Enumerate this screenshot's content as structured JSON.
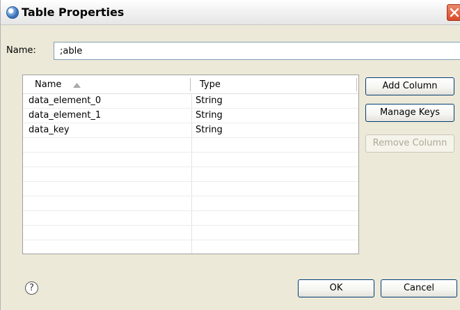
{
  "window": {
    "title": "Table Properties"
  },
  "name_field": {
    "label": "Name:",
    "value": ";able"
  },
  "table": {
    "columns": [
      "Name",
      "Type"
    ],
    "rows": [
      {
        "name": "data_element_0",
        "type": "String"
      },
      {
        "name": "data_element_1",
        "type": "String"
      },
      {
        "name": "data_key",
        "type": "String"
      }
    ],
    "empty_rows": 8
  },
  "side_buttons": {
    "add_column": "Add Column",
    "manage_keys": "Manage Keys",
    "remove_column": "Remove Column"
  },
  "footer": {
    "help": "?",
    "ok": "OK",
    "cancel": "Cancel"
  },
  "icons": {
    "app": "eclipse-app-icon",
    "close": "close-icon",
    "sort": "sort-ascending-icon",
    "help": "help-icon"
  }
}
